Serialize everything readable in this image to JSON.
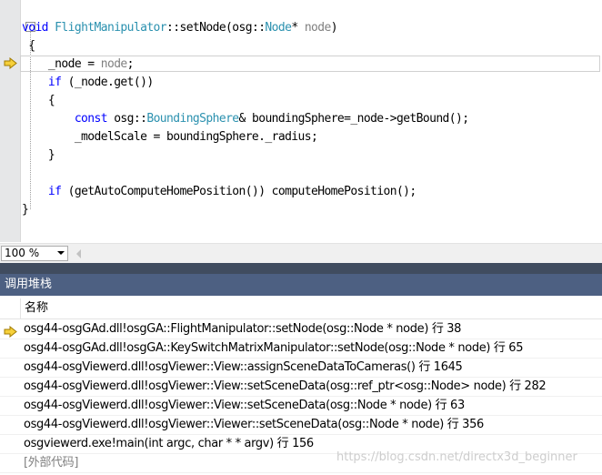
{
  "editor": {
    "lines": [
      [
        {
          "t": "void",
          "c": "kw"
        },
        {
          "t": " "
        },
        {
          "t": "FlightManipulator",
          "c": "ty"
        },
        {
          "t": "::setNode(osg::"
        },
        {
          "t": "Node",
          "c": "ty"
        },
        {
          "t": "* "
        },
        {
          "t": "node",
          "c": "pm"
        },
        {
          "t": ")"
        }
      ],
      [
        {
          "t": " {"
        }
      ],
      [
        {
          "t": "    _node = "
        },
        {
          "t": "node",
          "c": "pm"
        },
        {
          "t": ";"
        }
      ],
      [
        {
          "t": "    "
        },
        {
          "t": "if",
          "c": "kw"
        },
        {
          "t": " (_node.get())"
        }
      ],
      [
        {
          "t": "    {"
        }
      ],
      [
        {
          "t": "        "
        },
        {
          "t": "const",
          "c": "kw"
        },
        {
          "t": " osg::"
        },
        {
          "t": "BoundingSphere",
          "c": "ty"
        },
        {
          "t": "& boundingSphere=_node->getBound();"
        }
      ],
      [
        {
          "t": "        _modelScale = boundingSphere._radius;"
        }
      ],
      [
        {
          "t": "    }"
        }
      ],
      [
        {
          "t": ""
        }
      ],
      [
        {
          "t": "    "
        },
        {
          "t": "if",
          "c": "kw"
        },
        {
          "t": " (getAutoComputeHomePosition()) computeHomePosition();"
        }
      ],
      [
        {
          "t": "}"
        }
      ]
    ],
    "current_line_index": 2,
    "zoom": "100 %",
    "fold_marker": "-"
  },
  "call_stack": {
    "title": "调用堆栈",
    "column_name": "名称",
    "frames": [
      {
        "text": "osg44-osgGAd.dll!osgGA::FlightManipulator::setNode(osg::Node * node) 行 38",
        "current": true,
        "external": false
      },
      {
        "text": "osg44-osgGAd.dll!osgGA::KeySwitchMatrixManipulator::setNode(osg::Node * node) 行 65",
        "current": false,
        "external": false
      },
      {
        "text": "osg44-osgViewerd.dll!osgViewer::View::assignSceneDataToCameras() 行 1645",
        "current": false,
        "external": false
      },
      {
        "text": "osg44-osgViewerd.dll!osgViewer::View::setSceneData(osg::ref_ptr<osg::Node> node) 行 282",
        "current": false,
        "external": false
      },
      {
        "text": "osg44-osgViewerd.dll!osgViewer::View::setSceneData(osg::Node * node) 行 63",
        "current": false,
        "external": false
      },
      {
        "text": "osg44-osgViewerd.dll!osgViewer::Viewer::setSceneData(osg::Node * node) 行 356",
        "current": false,
        "external": false
      },
      {
        "text": "osgviewerd.exe!main(int argc, char * * argv) 行 156",
        "current": false,
        "external": false
      },
      {
        "text": "[外部代码]",
        "current": false,
        "external": true
      }
    ]
  },
  "watermark": "https://blog.csdn.net/directx3d_beginner",
  "colors": {
    "accent_header": "#4d6082",
    "splitter": "#404c5f",
    "arrow_fill": "#f6d03a",
    "arrow_stroke": "#a07a00"
  },
  "icons": {
    "current_statement": "yellow-arrow-icon",
    "scroll_left": "scroll-left-icon",
    "dropdown": "chevron-down-icon"
  }
}
